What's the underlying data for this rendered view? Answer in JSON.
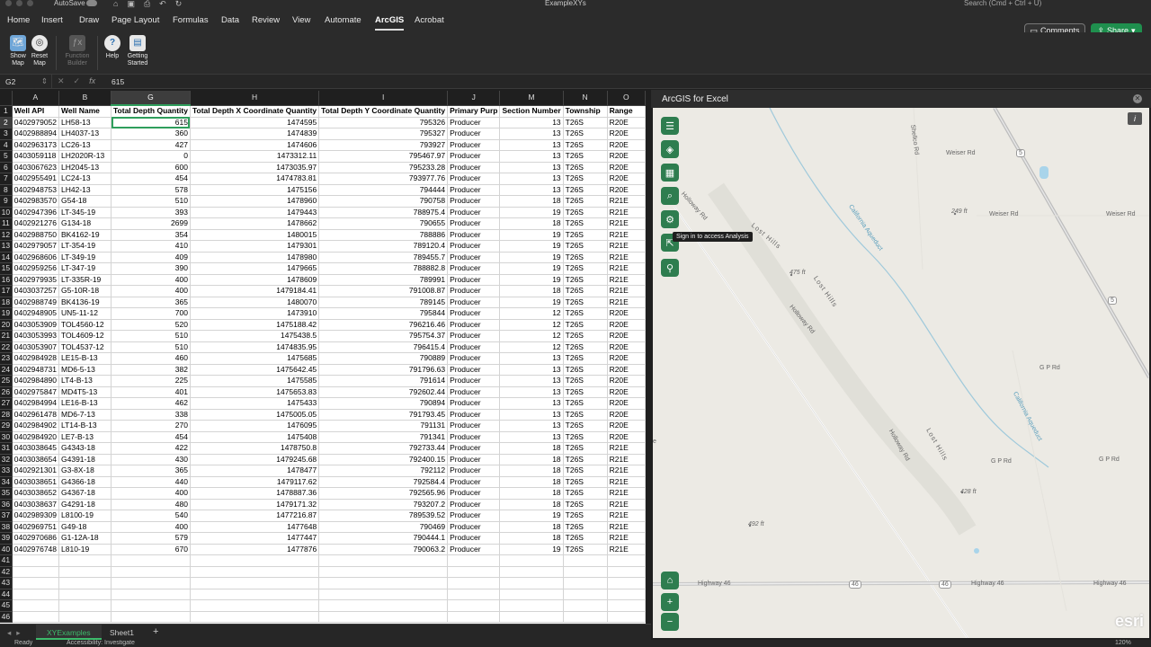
{
  "titlebar": {
    "autosave": "AutoSave",
    "filename": "ExampleXYs",
    "search_placeholder": "Search (Cmd + Ctrl + U)"
  },
  "menu": {
    "tabs": [
      "Home",
      "Insert",
      "Draw",
      "Page Layout",
      "Formulas",
      "Data",
      "Review",
      "View",
      "Automate",
      "ArcGIS",
      "Acrobat"
    ],
    "active": "ArcGIS",
    "comments": "Comments",
    "share": "Share"
  },
  "ribbon": {
    "show_map": "Show Map",
    "reset_map": "Reset Map",
    "function_builder": "Function Builder",
    "help": "Help",
    "getting_started": "Getting Started"
  },
  "formula": {
    "cell_ref": "G2",
    "value": "615"
  },
  "sheet": {
    "columns": [
      "A",
      "B",
      "G",
      "H",
      "I",
      "J",
      "M",
      "N",
      "O"
    ],
    "headers": [
      "Well API",
      "Well Name",
      "Total Depth Quantity",
      "Total Depth X Coordinate Quantity",
      "Total Depth Y Coordinate Quantity",
      "Primary Purp",
      "Section Number",
      "Township",
      "Range"
    ],
    "rows": [
      [
        "0402979052",
        "LH58-13",
        "615",
        "1474595",
        "795326",
        "Producer",
        "13",
        "T26S",
        "R20E"
      ],
      [
        "0402988894",
        "LH4037-13",
        "360",
        "1474839",
        "795327",
        "Producer",
        "13",
        "T26S",
        "R20E"
      ],
      [
        "0402963173",
        "LC26-13",
        "427",
        "1474606",
        "793927",
        "Producer",
        "13",
        "T26S",
        "R20E"
      ],
      [
        "0403059118",
        "LH2020R-13",
        "0",
        "1473312.11",
        "795467.97",
        "Producer",
        "13",
        "T26S",
        "R20E"
      ],
      [
        "0403067623",
        "LH2045-13",
        "600",
        "1473035.97",
        "795233.28",
        "Producer",
        "13",
        "T26S",
        "R20E"
      ],
      [
        "0402955491",
        "LC24-13",
        "454",
        "1474783.81",
        "793977.76",
        "Producer",
        "13",
        "T26S",
        "R20E"
      ],
      [
        "0402948753",
        "LH42-13",
        "578",
        "1475156",
        "794444",
        "Producer",
        "13",
        "T26S",
        "R20E"
      ],
      [
        "0402983570",
        "G54-18",
        "510",
        "1478960",
        "790758",
        "Producer",
        "18",
        "T26S",
        "R21E"
      ],
      [
        "0402947396",
        "LT-345-19",
        "393",
        "1479443",
        "788975.4",
        "Producer",
        "19",
        "T26S",
        "R21E"
      ],
      [
        "0402921276",
        "G134-18",
        "2699",
        "1478662",
        "790655",
        "Producer",
        "18",
        "T26S",
        "R21E"
      ],
      [
        "0402988750",
        "BK4162-19",
        "354",
        "1480015",
        "788886",
        "Producer",
        "19",
        "T26S",
        "R21E"
      ],
      [
        "0402979057",
        "LT-354-19",
        "410",
        "1479301",
        "789120.4",
        "Producer",
        "19",
        "T26S",
        "R21E"
      ],
      [
        "0402968606",
        "LT-349-19",
        "409",
        "1478980",
        "789455.7",
        "Producer",
        "19",
        "T26S",
        "R21E"
      ],
      [
        "0402959256",
        "LT-347-19",
        "390",
        "1479665",
        "788882.8",
        "Producer",
        "19",
        "T26S",
        "R21E"
      ],
      [
        "0402979935",
        "LT-335R-19",
        "400",
        "1478609",
        "789991",
        "Producer",
        "19",
        "T26S",
        "R21E"
      ],
      [
        "0403037257",
        "G5-10R-18",
        "400",
        "1479184.41",
        "791008.87",
        "Producer",
        "18",
        "T26S",
        "R21E"
      ],
      [
        "0402988749",
        "BK4136-19",
        "365",
        "1480070",
        "789145",
        "Producer",
        "19",
        "T26S",
        "R21E"
      ],
      [
        "0402948905",
        "UN5-11-12",
        "700",
        "1473910",
        "795844",
        "Producer",
        "12",
        "T26S",
        "R20E"
      ],
      [
        "0403053909",
        "TOL4560-12",
        "520",
        "1475188.42",
        "796216.46",
        "Producer",
        "12",
        "T26S",
        "R20E"
      ],
      [
        "0403053993",
        "TOL4609-12",
        "510",
        "1475438.5",
        "795754.37",
        "Producer",
        "12",
        "T26S",
        "R20E"
      ],
      [
        "0403053907",
        "TOL4537-12",
        "510",
        "1474835.95",
        "796415.4",
        "Producer",
        "12",
        "T26S",
        "R20E"
      ],
      [
        "0402984928",
        "LE15-B-13",
        "460",
        "1475685",
        "790889",
        "Producer",
        "13",
        "T26S",
        "R20E"
      ],
      [
        "0402948731",
        "MD6-5-13",
        "382",
        "1475642.45",
        "791796.63",
        "Producer",
        "13",
        "T26S",
        "R20E"
      ],
      [
        "0402984890",
        "LT4-B-13",
        "225",
        "1475585",
        "791614",
        "Producer",
        "13",
        "T26S",
        "R20E"
      ],
      [
        "0402975847",
        "MD4T5-13",
        "401",
        "1475653.83",
        "792602.44",
        "Producer",
        "13",
        "T26S",
        "R20E"
      ],
      [
        "0402984994",
        "LE16-B-13",
        "462",
        "1475433",
        "790894",
        "Producer",
        "13",
        "T26S",
        "R20E"
      ],
      [
        "0402961478",
        "MD6-7-13",
        "338",
        "1475005.05",
        "791793.45",
        "Producer",
        "13",
        "T26S",
        "R20E"
      ],
      [
        "0402984902",
        "LT14-B-13",
        "270",
        "1476095",
        "791131",
        "Producer",
        "13",
        "T26S",
        "R20E"
      ],
      [
        "0402984920",
        "LE7-B-13",
        "454",
        "1475408",
        "791341",
        "Producer",
        "13",
        "T26S",
        "R20E"
      ],
      [
        "0403038645",
        "G4343-18",
        "422",
        "1478750.8",
        "792733.44",
        "Producer",
        "18",
        "T26S",
        "R21E"
      ],
      [
        "0403038654",
        "G4391-18",
        "430",
        "1479245.68",
        "792400.15",
        "Producer",
        "18",
        "T26S",
        "R21E"
      ],
      [
        "0402921301",
        "G3-8X-18",
        "365",
        "1478477",
        "792112",
        "Producer",
        "18",
        "T26S",
        "R21E"
      ],
      [
        "0403038651",
        "G4366-18",
        "440",
        "1479117.62",
        "792584.4",
        "Producer",
        "18",
        "T26S",
        "R21E"
      ],
      [
        "0403038652",
        "G4367-18",
        "400",
        "1478887.36",
        "792565.96",
        "Producer",
        "18",
        "T26S",
        "R21E"
      ],
      [
        "0403038637",
        "G4291-18",
        "480",
        "1479171.32",
        "793207.2",
        "Producer",
        "18",
        "T26S",
        "R21E"
      ],
      [
        "0402989309",
        "L8100-19",
        "540",
        "1477216.87",
        "789539.52",
        "Producer",
        "19",
        "T26S",
        "R21E"
      ],
      [
        "0402969751",
        "G49-18",
        "400",
        "1477648",
        "790469",
        "Producer",
        "18",
        "T26S",
        "R21E"
      ],
      [
        "0402970686",
        "G1-12A-18",
        "579",
        "1477447",
        "790444.1",
        "Producer",
        "18",
        "T26S",
        "R21E"
      ],
      [
        "0402976748",
        "L810-19",
        "670",
        "1477876",
        "790063.2",
        "Producer",
        "19",
        "T26S",
        "R21E"
      ]
    ],
    "empty_rows": [
      "41",
      "42",
      "43",
      "44",
      "45",
      "46"
    ],
    "tabs": [
      "XYExamples",
      "Sheet1"
    ],
    "active_tab": "XYExamples"
  },
  "status": {
    "ready": "Ready",
    "accessibility": "Accessibility: Investigate",
    "zoom": "120%"
  },
  "map": {
    "title": "ArcGIS for Excel",
    "tooltip": "Sign in to access Analysis",
    "info": "i",
    "logo": "esri",
    "labels": {
      "weiser_rd_1": "Weiser Rd",
      "weiser_rd_2": "Weiser Rd",
      "weiser_rd_3": "Weiser Rd",
      "shellco": "Shellco Rd",
      "holloway_1": "Holloway Rd",
      "holloway_2": "Holloway Rd",
      "holloway_3": "Holloway Rd",
      "lost_hills_1": "Lost Hills",
      "lost_hills_2": "Lost Hills",
      "lost_hills_3": "Lost Hills",
      "aqueduct_1": "California Aqueduct",
      "aqueduct_2": "California Aqueduct",
      "gpr_1": "G P Rd",
      "gpr_2": "G P Rd",
      "gpr_3": "G P Rd",
      "hwy46_1": "Highway 46",
      "hwy46_2": "Highway 46",
      "hwy46_3": "Highway 46",
      "shield_46a": "46",
      "shield_46b": "46",
      "shield_5a": "5",
      "shield_5b": "5",
      "elev_249": "249 ft",
      "elev_475": "475 ft",
      "elev_428": "428 ft",
      "elev_492": "492 ft",
      "edge_e": "e"
    }
  }
}
